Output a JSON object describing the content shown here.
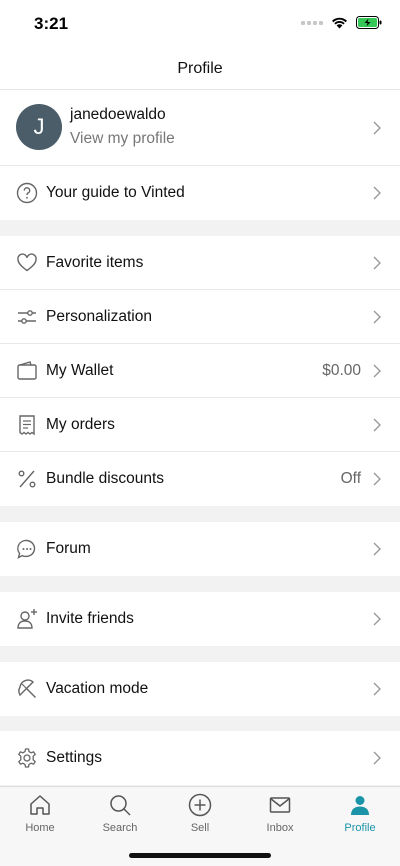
{
  "status_bar": {
    "time": "3:21"
  },
  "header": {
    "title": "Profile"
  },
  "profile": {
    "avatar_initial": "J",
    "username": "janedoewaldo",
    "link_label": "View my profile"
  },
  "guide": {
    "label": "Your guide to Vinted"
  },
  "menu": {
    "favorites": "Favorite items",
    "personalization": "Personalization",
    "wallet": "My Wallet",
    "wallet_value": "$0.00",
    "orders": "My orders",
    "bundle": "Bundle discounts",
    "bundle_value": "Off",
    "forum": "Forum",
    "invite": "Invite friends",
    "vacation": "Vacation mode",
    "settings": "Settings"
  },
  "tabs": {
    "home": "Home",
    "search": "Search",
    "sell": "Sell",
    "inbox": "Inbox",
    "profile": "Profile"
  },
  "colors": {
    "accent": "#1b94a7",
    "avatar_bg": "#4a5d68",
    "battery": "#37c759"
  }
}
